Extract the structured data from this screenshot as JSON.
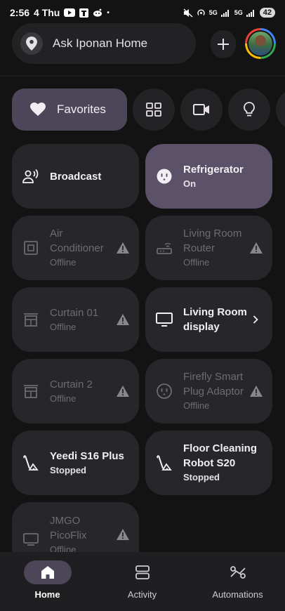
{
  "status_bar": {
    "time": "2:56",
    "date": "4 Thu",
    "net_label_1": "5G",
    "net_label_2": "5G",
    "battery": "42"
  },
  "header": {
    "search_label": "Ask Iponan Home",
    "search_icon": "location-pin-icon",
    "add_icon": "plus-icon",
    "avatar": "profile-avatar"
  },
  "filters": {
    "favorites_label": "Favorites",
    "favorites_icon": "heart-icon",
    "chips": [
      "grid-icon",
      "camera-icon",
      "lightbulb-icon"
    ]
  },
  "tiles": [
    {
      "name": "Broadcast",
      "status": "",
      "icon": "broadcast-icon",
      "state": "normal"
    },
    {
      "name": "Refrigerator",
      "status": "On",
      "icon": "plug-icon",
      "state": "active"
    },
    {
      "name": "Air Conditioner",
      "status": "Offline",
      "icon": "ac-icon",
      "state": "offline"
    },
    {
      "name": "Living Room Router",
      "status": "Offline",
      "icon": "router-icon",
      "state": "offline"
    },
    {
      "name": "Curtain 01",
      "status": "Offline",
      "icon": "curtain-icon",
      "state": "offline"
    },
    {
      "name": "Living Room display",
      "status": "",
      "icon": "display-icon",
      "state": "normal"
    },
    {
      "name": "Curtain 2",
      "status": "Offline",
      "icon": "curtain-icon",
      "state": "offline"
    },
    {
      "name": "Firefly Smart Plug Adaptor",
      "status": "Offline",
      "icon": "plug-icon",
      "state": "offline"
    },
    {
      "name": "Yeedi S16 Plus",
      "status": "Stopped",
      "icon": "vacuum-icon",
      "state": "normal"
    },
    {
      "name": "Floor Cleaning Robot S20",
      "status": "Stopped",
      "icon": "vacuum-icon",
      "state": "normal"
    },
    {
      "name": "JMGO PicoFlix",
      "status": "Offline",
      "icon": "tv-icon",
      "state": "offline"
    }
  ],
  "nav": {
    "items": [
      {
        "label": "Home",
        "icon": "home-icon"
      },
      {
        "label": "Activity",
        "icon": "activity-icon"
      },
      {
        "label": "Automations",
        "icon": "automations-icon"
      }
    ],
    "selected": "Home"
  },
  "colors": {
    "background": "#131313",
    "tile": "#27262a",
    "tile_active": "#5b5168",
    "chip_selected": "#4d4658"
  }
}
